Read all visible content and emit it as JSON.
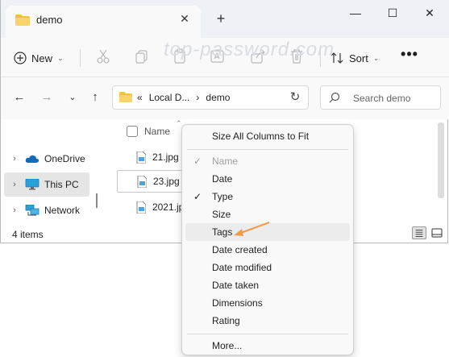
{
  "titlebar": {
    "tab_title": "demo",
    "close_tab": "✕",
    "new_tab": "+",
    "minimize": "—",
    "maximize": "☐",
    "close_window": "✕"
  },
  "watermark": "top-password.com",
  "commandbar": {
    "new_label": "New",
    "sort_label": "Sort",
    "more": "•••"
  },
  "nav": {
    "address_prefix": "«",
    "address_parts": [
      "Local D...",
      "demo"
    ],
    "address_sep": "›",
    "search_placeholder": "Search demo"
  },
  "sidebar": {
    "items": [
      {
        "label": "OneDrive",
        "icon": "cloud-icon"
      },
      {
        "label": "This PC",
        "icon": "monitor-icon"
      },
      {
        "label": "Network",
        "icon": "network-icon"
      }
    ]
  },
  "files": {
    "header_name": "Name",
    "rows": [
      "21.jpg",
      "23.jpg",
      "2021.jpg"
    ]
  },
  "status": {
    "count": "4 items"
  },
  "context_menu": {
    "size_all": "Size All Columns to Fit",
    "columns": [
      {
        "label": "Name",
        "checked": true,
        "disabled": true
      },
      {
        "label": "Date",
        "checked": false,
        "disabled": false
      },
      {
        "label": "Type",
        "checked": true,
        "disabled": false
      },
      {
        "label": "Size",
        "checked": false,
        "disabled": false
      },
      {
        "label": "Tags",
        "checked": false,
        "disabled": false,
        "highlighted": true
      },
      {
        "label": "Date created",
        "checked": false,
        "disabled": false
      },
      {
        "label": "Date modified",
        "checked": false,
        "disabled": false
      },
      {
        "label": "Date taken",
        "checked": false,
        "disabled": false
      },
      {
        "label": "Dimensions",
        "checked": false,
        "disabled": false
      },
      {
        "label": "Rating",
        "checked": false,
        "disabled": false
      }
    ],
    "more": "More..."
  },
  "colors": {
    "accent": "#0067c0",
    "folder": "#f0c23b",
    "annotation_arrow": "#f39b4b"
  }
}
